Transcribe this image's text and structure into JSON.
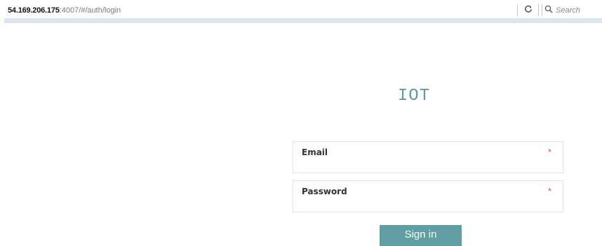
{
  "browser": {
    "url_host": "54.169.206.175",
    "url_path": ":4007/#/auth/login",
    "search_placeholder": "Search",
    "reload_icon": "reload-icon",
    "search_icon": "magnifier-icon"
  },
  "login": {
    "title": "IOT",
    "email_label": "Email",
    "password_label": "Password",
    "required_marker": "*",
    "submit_label": "Sign in"
  },
  "colors": {
    "accent": "#5f9ea3",
    "required": "#e0504a"
  }
}
